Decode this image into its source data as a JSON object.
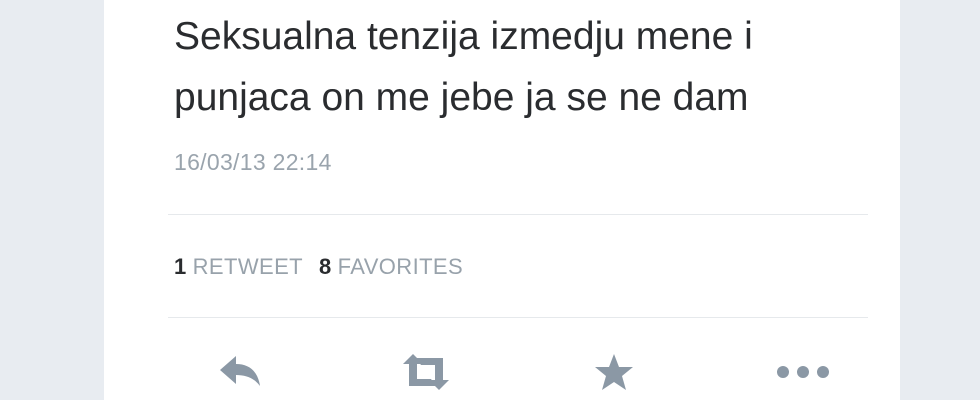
{
  "tweet": {
    "text_lines": [
      "Seksualna tenzija izmedju mene i",
      "punjaca on me jebe ja se ne dam"
    ],
    "timestamp": "16/03/13 22:14"
  },
  "stats": {
    "retweets_count": "1",
    "retweets_label": "RETWEET",
    "favorites_count": "8",
    "favorites_label": "FAVORITES"
  },
  "actions": [
    {
      "name": "reply",
      "icon": "reply-icon"
    },
    {
      "name": "retweet",
      "icon": "retweet-icon"
    },
    {
      "name": "favorite",
      "icon": "star-icon"
    },
    {
      "name": "more",
      "icon": "more-icon"
    }
  ],
  "colors": {
    "text": "#2a2c2f",
    "muted": "#98a2ab",
    "icon": "#8b98a5",
    "background": "#e9edf2",
    "card": "#ffffff"
  }
}
